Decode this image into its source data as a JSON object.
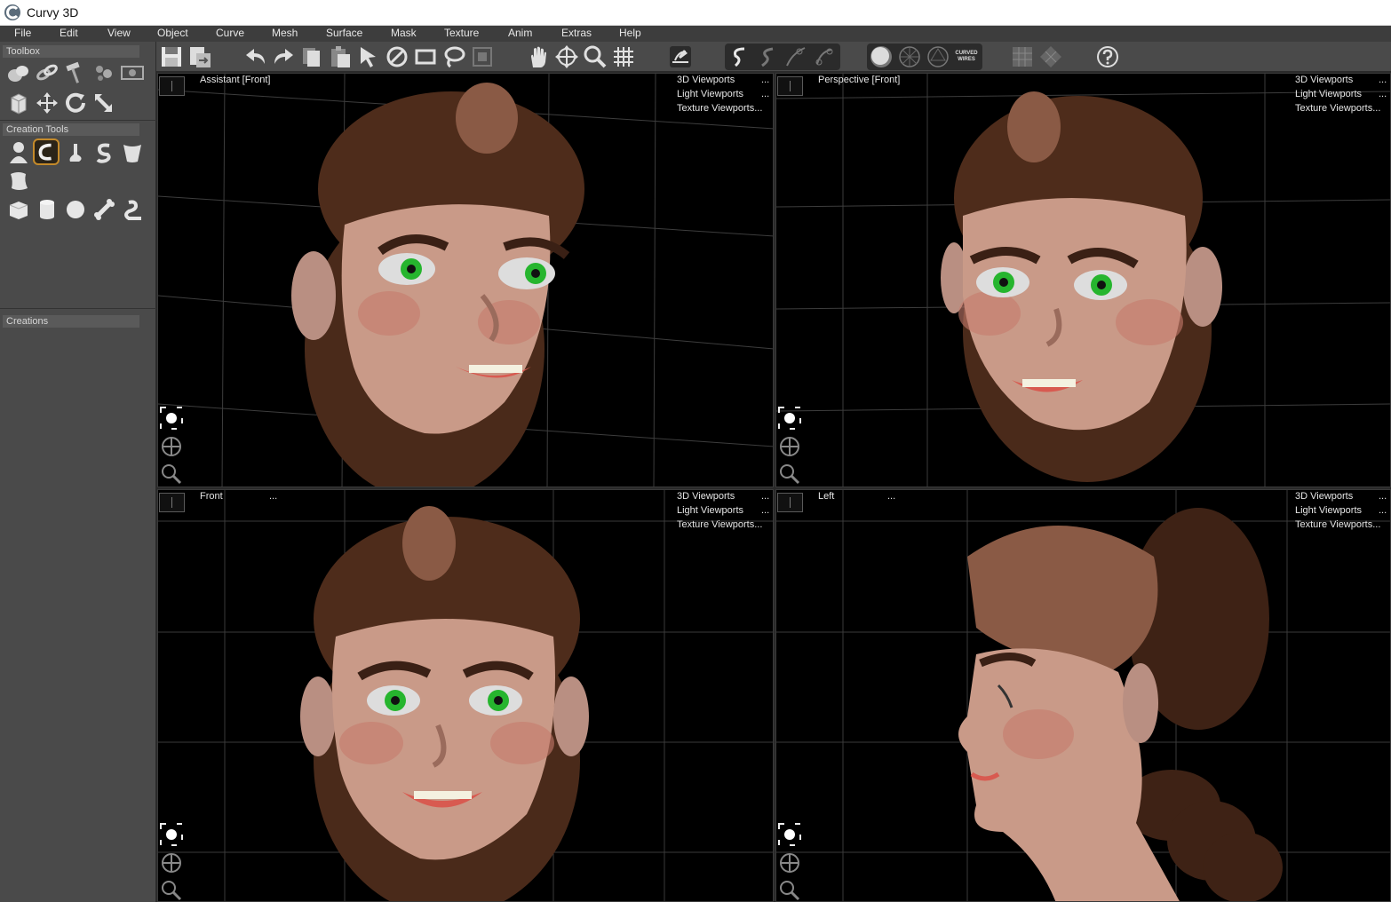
{
  "window": {
    "title": "Curvy 3D"
  },
  "menu": [
    "File",
    "Edit",
    "View",
    "Object",
    "Curve",
    "Mesh",
    "Surface",
    "Mask",
    "Texture",
    "Anim",
    "Extras",
    "Help"
  ],
  "left_panel": {
    "toolbox_label": "Toolbox",
    "creation_tools_label": "Creation Tools",
    "creations_label": "Creations"
  },
  "toolbar": {
    "curved_wires_line1": "CURVED",
    "curved_wires_line2": "WIRES"
  },
  "viewports": {
    "menu_3d": "3D Viewports",
    "menu_light": "Light Viewports",
    "menu_texture": "Texture Viewports...",
    "ellipsis": "...",
    "assistant": "Assistant [Front]",
    "perspective": "Perspective [Front]",
    "front": "Front",
    "left": "Left"
  },
  "colors": {
    "background": "#000000",
    "panel": "#4a4a4a",
    "accent": "#c48a2a",
    "grid": "#3a3a3a"
  }
}
